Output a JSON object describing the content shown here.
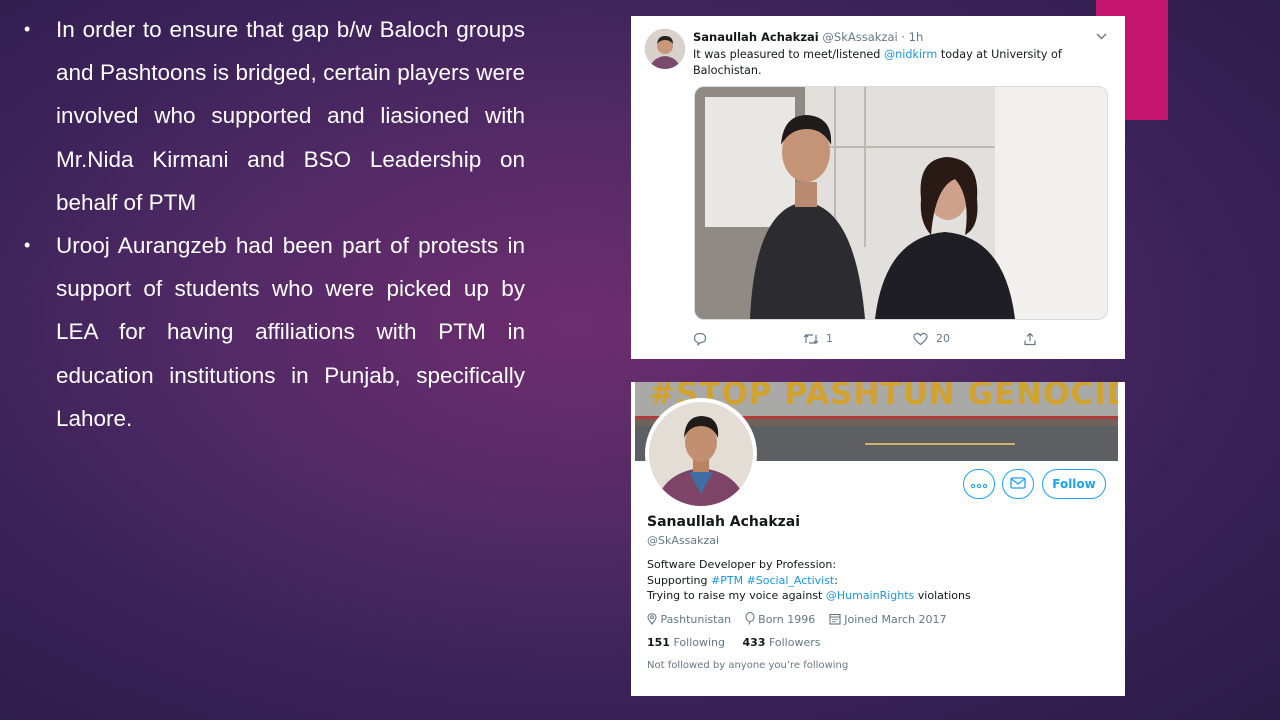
{
  "bullets": [
    "In order to ensure that gap b/w Baloch groups and Pashtoons is bridged, certain players were involved who supported and liasioned with Mr.Nida Kirmani and BSO Leadership on behalf of PTM",
    "Urooj Aurangzeb had been part of protests in support of students who were picked up by LEA for having affiliations with PTM in education institutions in Punjab, specifically Lahore."
  ],
  "bullet_glyph": "•",
  "tweet": {
    "name": "Sanaullah Achakzai",
    "handle": "@SkAssakzai",
    "time": "· 1h",
    "text_before": "It was pleasured to meet/listened ",
    "mention": "@nidkirm",
    "text_after": " today at University of Balochistan.",
    "retweets": "1",
    "likes": "20",
    "icons": [
      "reply-icon",
      "retweet-icon",
      "like-icon",
      "share-icon",
      "chevron-down-icon"
    ]
  },
  "profile": {
    "banner_text": "#STOP PASHTUN GENOCIDE",
    "follow_label": "Follow",
    "name": "Sanaullah Achakzai",
    "handle": "@SkAssakzai",
    "bio_line1": "Software Developer by Profession:",
    "bio_line2_prefix": "Supporting ",
    "bio_tags": "#PTM #Social_Activist",
    "bio_line2_suffix": ":",
    "bio_line3_prefix": "Trying to raise my voice against ",
    "bio_mention": "@HumainRights",
    "bio_line3_suffix": " violations",
    "location": "Pashtunistan",
    "born": "Born 1996",
    "joined": "Joined March 2017",
    "following_count": "151",
    "following_label": "Following",
    "followers_count": "433",
    "followers_label": "Followers",
    "note": "Not followed by anyone you’re following"
  },
  "colors": {
    "accent": "#c4166f",
    "link": "#1b95e0",
    "twitter_blue": "#1da1f2"
  }
}
